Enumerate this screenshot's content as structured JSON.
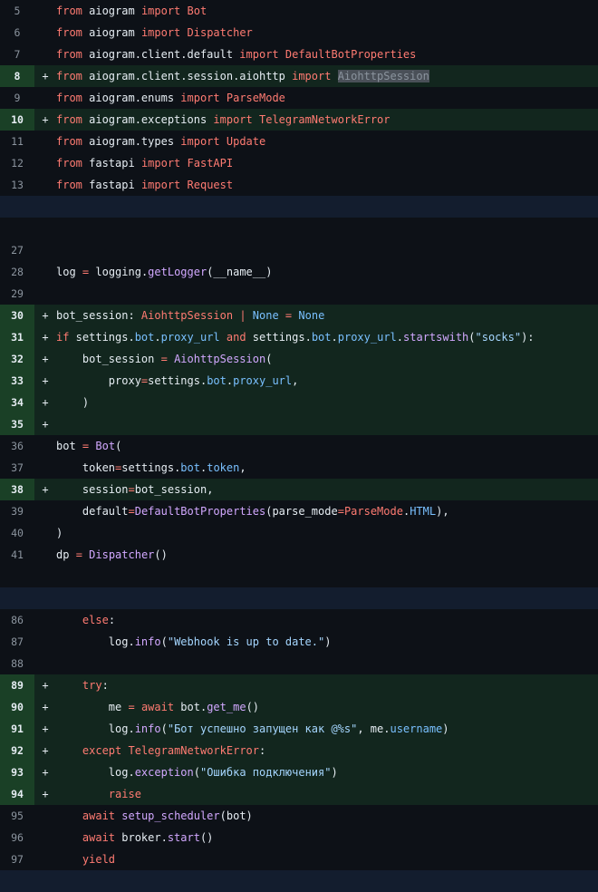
{
  "diff": {
    "sections": [
      {
        "kind": "lines",
        "lines": [
          {
            "num": "5",
            "type": "ctx",
            "tokens": [
              [
                "kw",
                "from"
              ],
              [
                "txt",
                " aiogram "
              ],
              [
                "kw",
                "import"
              ],
              [
                "txt",
                " "
              ],
              [
                "kw",
                "Bot"
              ]
            ]
          },
          {
            "num": "6",
            "type": "ctx",
            "tokens": [
              [
                "kw",
                "from"
              ],
              [
                "txt",
                " aiogram "
              ],
              [
                "kw",
                "import"
              ],
              [
                "txt",
                " "
              ],
              [
                "kw",
                "Dispatcher"
              ]
            ]
          },
          {
            "num": "7",
            "type": "ctx",
            "tokens": [
              [
                "kw",
                "from"
              ],
              [
                "txt",
                " aiogram.client.default "
              ],
              [
                "kw",
                "import"
              ],
              [
                "txt",
                " "
              ],
              [
                "kw",
                "DefaultBotProperties"
              ]
            ]
          },
          {
            "num": "8",
            "type": "add",
            "tokens": [
              [
                "kw",
                "from"
              ],
              [
                "txt",
                " aiogram.client.session.aiohttp "
              ],
              [
                "kw",
                "import"
              ],
              [
                "txt",
                " "
              ],
              [
                "hl",
                "AiohttpSession"
              ]
            ]
          },
          {
            "num": "9",
            "type": "ctx",
            "tokens": [
              [
                "kw",
                "from"
              ],
              [
                "txt",
                " aiogram.enums "
              ],
              [
                "kw",
                "import"
              ],
              [
                "txt",
                " "
              ],
              [
                "kw",
                "ParseMode"
              ]
            ]
          },
          {
            "num": "10",
            "type": "add",
            "tokens": [
              [
                "kw",
                "from"
              ],
              [
                "txt",
                " aiogram.exceptions "
              ],
              [
                "kw",
                "import"
              ],
              [
                "txt",
                " "
              ],
              [
                "kw",
                "TelegramNetworkError"
              ]
            ]
          },
          {
            "num": "11",
            "type": "ctx",
            "tokens": [
              [
                "kw",
                "from"
              ],
              [
                "txt",
                " aiogram.types "
              ],
              [
                "kw",
                "import"
              ],
              [
                "txt",
                " "
              ],
              [
                "kw",
                "Update"
              ]
            ]
          },
          {
            "num": "12",
            "type": "ctx",
            "tokens": [
              [
                "kw",
                "from"
              ],
              [
                "txt",
                " fastapi "
              ],
              [
                "kw",
                "import"
              ],
              [
                "txt",
                " "
              ],
              [
                "kw",
                "FastAPI"
              ]
            ]
          },
          {
            "num": "13",
            "type": "ctx",
            "tokens": [
              [
                "kw",
                "from"
              ],
              [
                "txt",
                " fastapi "
              ],
              [
                "kw",
                "import"
              ],
              [
                "txt",
                " "
              ],
              [
                "kw",
                "Request"
              ]
            ]
          }
        ]
      },
      {
        "kind": "hunk"
      },
      {
        "kind": "lines",
        "lines": [
          {
            "num": "",
            "type": "ctx",
            "tokens": []
          },
          {
            "num": "27",
            "type": "ctx",
            "tokens": []
          },
          {
            "num": "28",
            "type": "ctx",
            "tokens": [
              [
                "txt",
                "log "
              ],
              [
                "kw",
                "="
              ],
              [
                "txt",
                " logging."
              ],
              [
                "fn",
                "getLogger"
              ],
              [
                "txt",
                "(__name__)"
              ]
            ]
          },
          {
            "num": "29",
            "type": "ctx",
            "tokens": []
          },
          {
            "num": "30",
            "type": "add",
            "tokens": [
              [
                "txt",
                "bot_session: "
              ],
              [
                "kw",
                "AiohttpSession"
              ],
              [
                "txt",
                " "
              ],
              [
                "kw",
                "|"
              ],
              [
                "txt",
                " "
              ],
              [
                "prop",
                "None"
              ],
              [
                "txt",
                " "
              ],
              [
                "kw",
                "="
              ],
              [
                "txt",
                " "
              ],
              [
                "prop",
                "None"
              ]
            ]
          },
          {
            "num": "31",
            "type": "add",
            "tokens": [
              [
                "kw",
                "if"
              ],
              [
                "txt",
                " settings."
              ],
              [
                "prop",
                "bot"
              ],
              [
                "txt",
                "."
              ],
              [
                "prop",
                "proxy_url"
              ],
              [
                "txt",
                " "
              ],
              [
                "kw",
                "and"
              ],
              [
                "txt",
                " settings."
              ],
              [
                "prop",
                "bot"
              ],
              [
                "txt",
                "."
              ],
              [
                "prop",
                "proxy_url"
              ],
              [
                "txt",
                "."
              ],
              [
                "fn",
                "startswith"
              ],
              [
                "txt",
                "("
              ],
              [
                "str",
                "\"socks\""
              ],
              [
                "txt",
                "):"
              ]
            ]
          },
          {
            "num": "32",
            "type": "add",
            "tokens": [
              [
                "txt",
                "    bot_session "
              ],
              [
                "kw",
                "="
              ],
              [
                "txt",
                " "
              ],
              [
                "fn",
                "AiohttpSession"
              ],
              [
                "txt",
                "("
              ]
            ]
          },
          {
            "num": "33",
            "type": "add",
            "tokens": [
              [
                "txt",
                "        proxy"
              ],
              [
                "kw",
                "="
              ],
              [
                "txt",
                "settings."
              ],
              [
                "prop",
                "bot"
              ],
              [
                "txt",
                "."
              ],
              [
                "prop",
                "proxy_url"
              ],
              [
                "txt",
                ","
              ]
            ]
          },
          {
            "num": "34",
            "type": "add",
            "tokens": [
              [
                "txt",
                "    )"
              ]
            ]
          },
          {
            "num": "35",
            "type": "add",
            "tokens": []
          },
          {
            "num": "36",
            "type": "ctx",
            "tokens": [
              [
                "txt",
                "bot "
              ],
              [
                "kw",
                "="
              ],
              [
                "txt",
                " "
              ],
              [
                "fn",
                "Bot"
              ],
              [
                "txt",
                "("
              ]
            ]
          },
          {
            "num": "37",
            "type": "ctx",
            "tokens": [
              [
                "txt",
                "    token"
              ],
              [
                "kw",
                "="
              ],
              [
                "txt",
                "settings."
              ],
              [
                "prop",
                "bot"
              ],
              [
                "txt",
                "."
              ],
              [
                "prop",
                "token"
              ],
              [
                "txt",
                ","
              ]
            ]
          },
          {
            "num": "38",
            "type": "add",
            "tokens": [
              [
                "txt",
                "    session"
              ],
              [
                "kw",
                "="
              ],
              [
                "txt",
                "bot_session,"
              ]
            ]
          },
          {
            "num": "39",
            "type": "ctx",
            "tokens": [
              [
                "txt",
                "    default"
              ],
              [
                "kw",
                "="
              ],
              [
                "fn",
                "DefaultBotProperties"
              ],
              [
                "txt",
                "(parse_mode"
              ],
              [
                "kw",
                "="
              ],
              [
                "kw",
                "ParseMode"
              ],
              [
                "txt",
                "."
              ],
              [
                "prop",
                "HTML"
              ],
              [
                "txt",
                "),"
              ]
            ]
          },
          {
            "num": "40",
            "type": "ctx",
            "tokens": [
              [
                "txt",
                ")"
              ]
            ]
          },
          {
            "num": "41",
            "type": "ctx",
            "tokens": [
              [
                "txt",
                "dp "
              ],
              [
                "kw",
                "="
              ],
              [
                "txt",
                " "
              ],
              [
                "fn",
                "Dispatcher"
              ],
              [
                "txt",
                "()"
              ]
            ]
          },
          {
            "num": "",
            "type": "ctx",
            "tokens": []
          }
        ]
      },
      {
        "kind": "hunk"
      },
      {
        "kind": "lines",
        "lines": [
          {
            "num": "86",
            "type": "ctx",
            "tokens": [
              [
                "txt",
                "    "
              ],
              [
                "kw",
                "else"
              ],
              [
                "txt",
                ":"
              ]
            ]
          },
          {
            "num": "87",
            "type": "ctx",
            "tokens": [
              [
                "txt",
                "        log."
              ],
              [
                "fn",
                "info"
              ],
              [
                "txt",
                "("
              ],
              [
                "str",
                "\"Webhook is up to date.\""
              ],
              [
                "txt",
                ")"
              ]
            ]
          },
          {
            "num": "88",
            "type": "ctx",
            "tokens": []
          },
          {
            "num": "89",
            "type": "add",
            "tokens": [
              [
                "txt",
                "    "
              ],
              [
                "kw",
                "try"
              ],
              [
                "txt",
                ":"
              ]
            ]
          },
          {
            "num": "90",
            "type": "add",
            "tokens": [
              [
                "txt",
                "        me "
              ],
              [
                "kw",
                "="
              ],
              [
                "txt",
                " "
              ],
              [
                "kw",
                "await"
              ],
              [
                "txt",
                " bot."
              ],
              [
                "fn",
                "get_me"
              ],
              [
                "txt",
                "()"
              ]
            ]
          },
          {
            "num": "91",
            "type": "add",
            "tokens": [
              [
                "txt",
                "        log."
              ],
              [
                "fn",
                "info"
              ],
              [
                "txt",
                "("
              ],
              [
                "str",
                "\"Бот успешно запущен как @%s\""
              ],
              [
                "txt",
                ", me."
              ],
              [
                "prop",
                "username"
              ],
              [
                "txt",
                ")"
              ]
            ]
          },
          {
            "num": "92",
            "type": "add",
            "tokens": [
              [
                "txt",
                "    "
              ],
              [
                "kw",
                "except"
              ],
              [
                "txt",
                " "
              ],
              [
                "kw",
                "TelegramNetworkError"
              ],
              [
                "txt",
                ":"
              ]
            ]
          },
          {
            "num": "93",
            "type": "add",
            "tokens": [
              [
                "txt",
                "        log."
              ],
              [
                "fn",
                "exception"
              ],
              [
                "txt",
                "("
              ],
              [
                "str",
                "\"Ошибка подключения\""
              ],
              [
                "txt",
                ")"
              ]
            ]
          },
          {
            "num": "94",
            "type": "add",
            "tokens": [
              [
                "txt",
                "        "
              ],
              [
                "kw",
                "raise"
              ]
            ]
          },
          {
            "num": "95",
            "type": "ctx",
            "tokens": [
              [
                "txt",
                "    "
              ],
              [
                "kw",
                "await"
              ],
              [
                "txt",
                " "
              ],
              [
                "fn",
                "setup_scheduler"
              ],
              [
                "txt",
                "(bot)"
              ]
            ]
          },
          {
            "num": "96",
            "type": "ctx",
            "tokens": [
              [
                "txt",
                "    "
              ],
              [
                "kw",
                "await"
              ],
              [
                "txt",
                " broker."
              ],
              [
                "fn",
                "start"
              ],
              [
                "txt",
                "()"
              ]
            ]
          },
          {
            "num": "97",
            "type": "ctx",
            "tokens": [
              [
                "txt",
                "    "
              ],
              [
                "kw",
                "yield"
              ]
            ]
          }
        ]
      },
      {
        "kind": "hunk"
      }
    ]
  }
}
